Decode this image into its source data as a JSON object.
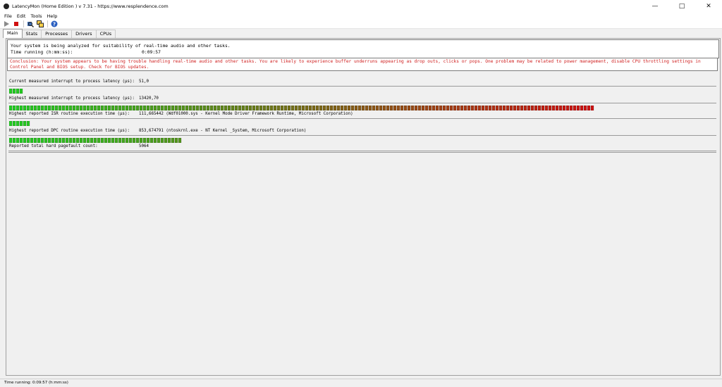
{
  "window": {
    "title": "LatencyMon  (Home Edition )  v 7.31 - https://www.resplendence.com"
  },
  "menu": [
    "File",
    "Edit",
    "Tools",
    "Help"
  ],
  "toolbar": {
    "icons": [
      "play-icon",
      "stop-icon",
      "search-icon",
      "windows-icon",
      "help-icon"
    ]
  },
  "tabs": [
    "Main",
    "Stats",
    "Processes",
    "Drivers",
    "CPUs"
  ],
  "active_tab": "Main",
  "main": {
    "status_line": "Your system is being analyzed for suitability of real-time audio and other tasks.",
    "time_running_label": "Time running (h:mm:ss):",
    "time_running_value": "0:09:57",
    "conclusion": "Conclusion: Your system appears to be having trouble handling real-time audio and other tasks. You are likely to experience buffer underruns appearing as drop outs, clicks or pops. One problem may be related to power management, disable CPU throttling settings in Control Panel and BIOS setup. Check for BIOS updates.",
    "conclusion_color": "#d02020",
    "metrics": [
      {
        "label": "Current measured interrupt to process latency (µs):",
        "value": "51,0",
        "bar_fraction": 0.02
      },
      {
        "label": "Highest measured interrupt to process latency (µs):",
        "value": "13420,70",
        "bar_fraction": 0.83
      },
      {
        "label": "Highest reported ISR routine execution time (µs):",
        "value": "111,665442   (Wdf01000.sys - Kernel Mode Driver Framework Runtime, Microsoft Corporation)",
        "bar_fraction": 0.032
      },
      {
        "label": "Highest reported DPC routine execution time (µs):",
        "value": "853,674791   (ntoskrnl.exe - NT Kernel _System, Microsoft Corporation)",
        "bar_fraction": 0.245
      },
      {
        "label": "Reported total hard pagefault count:",
        "value": "5064",
        "bar_fraction": null
      }
    ]
  },
  "statusbar": {
    "text": "Time running: 0:09:57  (h:mm:ss)"
  },
  "colors": {
    "bar_green": "#22cc22",
    "bar_red": "#cc1111",
    "stop_red": "#d01010"
  }
}
